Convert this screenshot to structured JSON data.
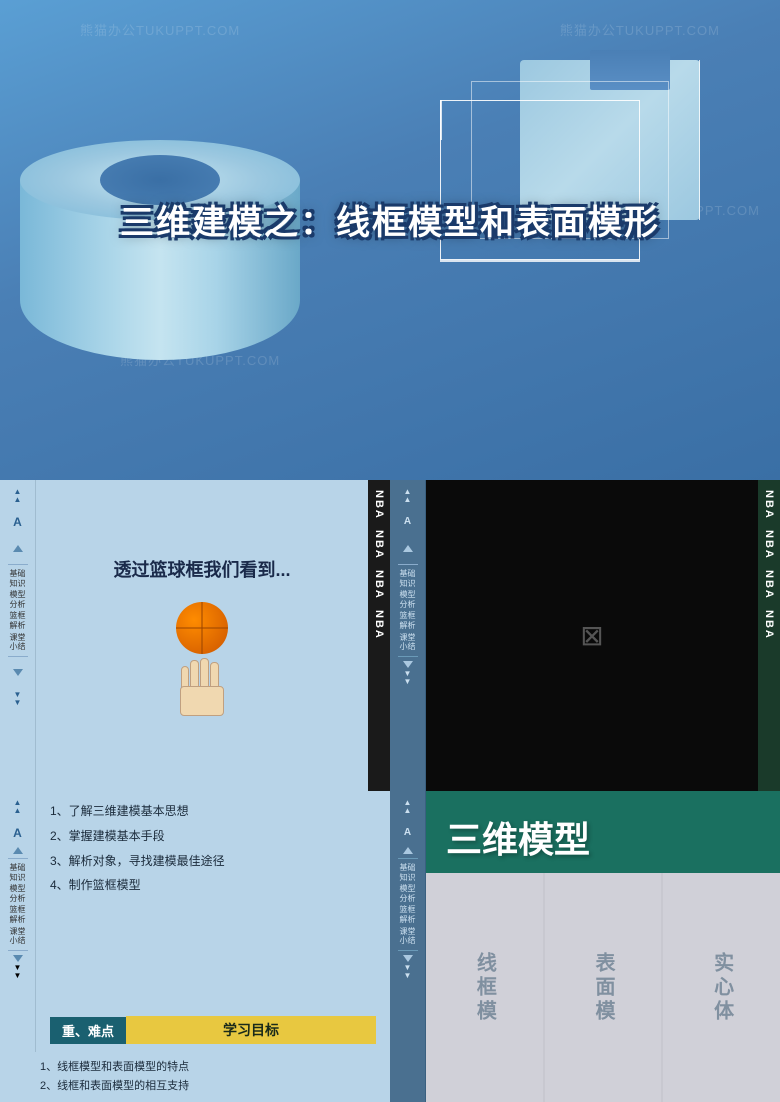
{
  "top": {
    "title": "三维建模之：线框模型和表面模形",
    "watermarks": [
      "熊猫办公TUKUPPT.COM",
      "熊猫办公TUKUPPT.COM",
      "熊猫办公TUKUPPT.COM",
      "熊猫办公TUKUPPT.COM",
      "熊猫办公TUKUPPT.COM"
    ]
  },
  "slides": {
    "basketball": {
      "header_text": "透过篮球框我们看到...",
      "nba_labels": [
        "NBA",
        "NBA",
        "NBA",
        "NBA"
      ]
    },
    "black": {
      "broken_icon": "⊠",
      "nba_labels": [
        "NBA",
        "NBA",
        "NBA",
        "NBA"
      ]
    },
    "objectives": {
      "items": [
        "1、了解三维建模基本思想",
        "2、掌握建模基本手段",
        "3、解析对象，寻找建模最佳途径",
        "4、制作篮框模型"
      ],
      "section_label": "学习目标",
      "key_label": "重、难点",
      "key_items": [
        "1、线框模型和表面模型的特点",
        "2、线框和表面模型的相互支持"
      ]
    },
    "model3d": {
      "title": "三维模型",
      "cards": [
        "线框模",
        "表面模",
        "实心体"
      ]
    }
  },
  "sidebar": {
    "items": [
      {
        "icon": "▲▲",
        "label": ""
      },
      {
        "icon": "A",
        "label": ""
      },
      {
        "icon": "▲",
        "label": ""
      },
      {
        "label1": "基础",
        "label2": "知识"
      },
      {
        "label1": "模型",
        "label2": "分析"
      },
      {
        "label1": "篮框",
        "label2": "解析"
      },
      {
        "label1": "课堂",
        "label2": "小结"
      },
      {
        "icon": "▼",
        "label": ""
      },
      {
        "icon": "▼▼",
        "label": ""
      }
    ]
  }
}
